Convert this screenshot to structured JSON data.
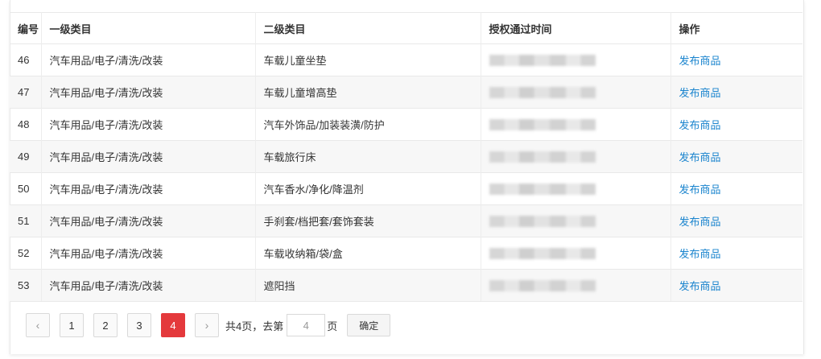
{
  "table": {
    "headers": {
      "id": "编号",
      "category1": "一级类目",
      "category2": "二级类目",
      "auth_time": "授权通过时间",
      "action": "操作"
    },
    "rows": [
      {
        "id": "46",
        "category1": "汽车用品/电子/清洗/改装",
        "category2": "车载儿童坐垫",
        "action": "发布商品"
      },
      {
        "id": "47",
        "category1": "汽车用品/电子/清洗/改装",
        "category2": "车载儿童增高垫",
        "action": "发布商品"
      },
      {
        "id": "48",
        "category1": "汽车用品/电子/清洗/改装",
        "category2": "汽车外饰品/加装装潢/防护",
        "action": "发布商品"
      },
      {
        "id": "49",
        "category1": "汽车用品/电子/清洗/改装",
        "category2": "车载旅行床",
        "action": "发布商品"
      },
      {
        "id": "50",
        "category1": "汽车用品/电子/清洗/改装",
        "category2": "汽车香水/净化/降温剂",
        "action": "发布商品"
      },
      {
        "id": "51",
        "category1": "汽车用品/电子/清洗/改装",
        "category2": "手刹套/档把套/套饰套装",
        "action": "发布商品"
      },
      {
        "id": "52",
        "category1": "汽车用品/电子/清洗/改装",
        "category2": "车载收纳箱/袋/盒",
        "action": "发布商品"
      },
      {
        "id": "53",
        "category1": "汽车用品/电子/清洗/改装",
        "category2": "遮阳挡",
        "action": "发布商品"
      }
    ]
  },
  "pagination": {
    "prev_icon": "chevron-left-icon",
    "next_icon": "chevron-right-icon",
    "pages": [
      "1",
      "2",
      "3",
      "4"
    ],
    "current": "4",
    "total_text": "共4页，去第",
    "page_suffix": "页",
    "goto_value": "4",
    "confirm_label": "确定"
  },
  "colors": {
    "accent": "#e4393c",
    "link": "#1a84ce"
  }
}
